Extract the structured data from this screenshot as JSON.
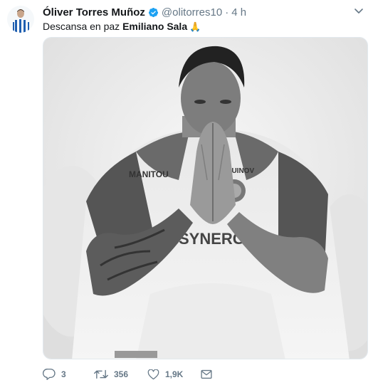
{
  "author": {
    "display_name": "Óliver Torres Muñoz",
    "handle": "@olitorres10",
    "separator": "·",
    "time": "4 h",
    "verified_icon": "verified-badge-icon",
    "avatar_icon": "avatar"
  },
  "tweet": {
    "text_plain": "Descansa en paz ",
    "text_bold": "Emiliano Sala",
    "emoji": "🙏"
  },
  "media": {
    "kind": "photo-grayscale",
    "jersey_sponsor_left": "MANITOU",
    "jersey_sponsor_right": "PROQUINOV",
    "jersey_front": "SYNERGIE"
  },
  "actions": {
    "reply_count": "3",
    "retweet_count": "356",
    "like_count": "1,9K",
    "reply_icon": "reply-icon",
    "retweet_icon": "retweet-icon",
    "like_icon": "heart-icon",
    "dm_icon": "envelope-icon"
  },
  "colors": {
    "verified_blue": "#1da1f2",
    "icon_gray": "#657786",
    "text": "#14171a"
  }
}
